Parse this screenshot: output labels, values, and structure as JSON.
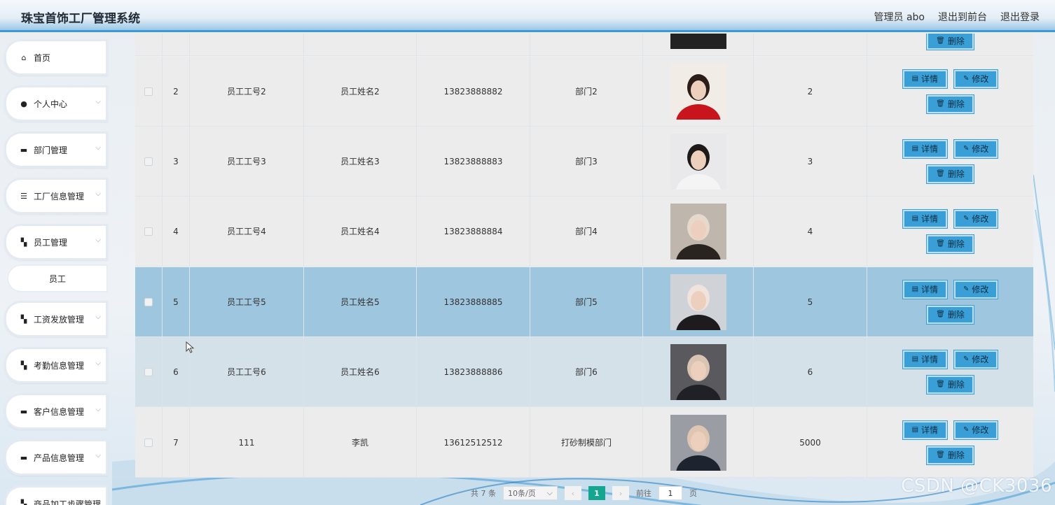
{
  "app": {
    "title": "珠宝首饰工厂管理系统"
  },
  "header": {
    "user": "管理员 abo",
    "front_link": "退出到前台",
    "logout": "退出登录"
  },
  "sidebar": {
    "items": [
      {
        "label": "首页",
        "icon": "home-icon"
      },
      {
        "label": "个人中心",
        "icon": "user-icon"
      },
      {
        "label": "部门管理",
        "icon": "monitor-icon"
      },
      {
        "label": "工厂信息管理",
        "icon": "list-icon"
      },
      {
        "label": "员工管理",
        "icon": "grid-icon"
      },
      {
        "label": "员工",
        "icon": ""
      },
      {
        "label": "工资发放管理",
        "icon": "grid-icon"
      },
      {
        "label": "考勤信息管理",
        "icon": "grid-icon"
      },
      {
        "label": "客户信息管理",
        "icon": "folder-icon"
      },
      {
        "label": "产品信息管理",
        "icon": "folder-icon"
      },
      {
        "label": "商品加工步骤管理",
        "icon": "grid-icon"
      }
    ]
  },
  "table": {
    "actions": {
      "detail": "详情",
      "edit": "修改",
      "delete": "删除"
    },
    "rows": [
      {
        "idx": "2",
        "no": "员工工号2",
        "name": "员工姓名2",
        "phone": "13823888882",
        "dept": "部门2",
        "num": "2"
      },
      {
        "idx": "3",
        "no": "员工工号3",
        "name": "员工姓名3",
        "phone": "13823888883",
        "dept": "部门3",
        "num": "3"
      },
      {
        "idx": "4",
        "no": "员工工号4",
        "name": "员工姓名4",
        "phone": "13823888884",
        "dept": "部门4",
        "num": "4"
      },
      {
        "idx": "5",
        "no": "员工工号5",
        "name": "员工姓名5",
        "phone": "13823888885",
        "dept": "部门5",
        "num": "5"
      },
      {
        "idx": "6",
        "no": "员工工号6",
        "name": "员工姓名6",
        "phone": "13823888886",
        "dept": "部门6",
        "num": "6"
      },
      {
        "idx": "7",
        "no": "111",
        "name": "李凯",
        "phone": "13612512512",
        "dept": "打砂制模部门",
        "num": "5000"
      }
    ]
  },
  "pagination": {
    "total": "共 7 条",
    "page_size": "10条/页",
    "current": "1",
    "goto_label": "前往",
    "goto_value": "1",
    "page_suffix": "页"
  },
  "watermark": "CSDN @CK3036",
  "colors": {
    "accent": "#3a9fd6",
    "active_page": "#14a68f",
    "row_highlight": "#9ec6de"
  }
}
